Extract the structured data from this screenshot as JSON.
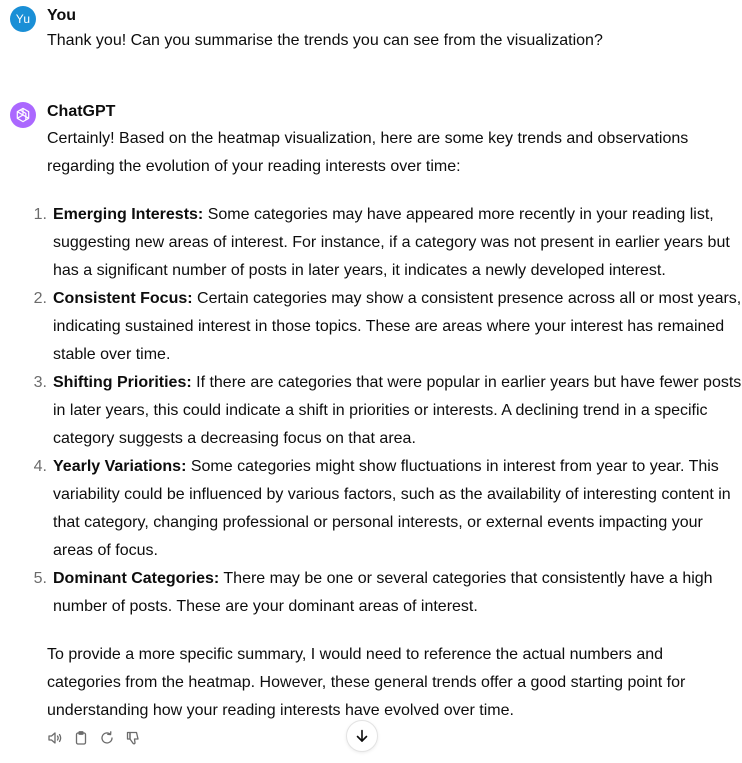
{
  "user_message": {
    "avatar_initials": "Yu",
    "author": "You",
    "text": "Thank you! Can you summarise the trends you can see from the visualization?"
  },
  "assistant_message": {
    "author": "ChatGPT",
    "intro": "Certainly! Based on the heatmap visualization, here are some key trends and observations regarding the evolution of your reading interests over time:",
    "points": [
      {
        "number": "1.",
        "title": "Emerging Interests:",
        "text": " Some categories may have appeared more recently in your reading list, suggesting new areas of interest. For instance, if a category was not present in earlier years but has a significant number of posts in later years, it indicates a newly developed interest."
      },
      {
        "number": "2.",
        "title": "Consistent Focus:",
        "text": " Certain categories may show a consistent presence across all or most years, indicating sustained interest in those topics. These are areas where your interest has remained stable over time."
      },
      {
        "number": "3.",
        "title": "Shifting Priorities:",
        "text": " If there are categories that were popular in earlier years but have fewer posts in later years, this could indicate a shift in priorities or interests. A declining trend in a specific category suggests a decreasing focus on that area."
      },
      {
        "number": "4.",
        "title": "Yearly Variations:",
        "text": " Some categories might show fluctuations in interest from year to year. This variability could be influenced by various factors, such as the availability of interesting content in that category, changing professional or personal interests, or external events impacting your areas of focus."
      },
      {
        "number": "5.",
        "title": "Dominant Categories:",
        "text": " There may be one or several categories that consistently have a high number of posts. These are your dominant areas of interest."
      }
    ],
    "outro": "To provide a more specific summary, I would need to reference the actual numbers and categories from the heatmap. However, these general trends offer a good starting point for understanding how your reading interests have evolved over time.",
    "actions": [
      "read-aloud-icon",
      "copy-icon",
      "regenerate-icon",
      "thumbs-down-icon"
    ]
  },
  "scroll_button": {
    "icon": "arrow-down-icon"
  },
  "colors": {
    "user_avatar": "#1a8fd6",
    "bot_avatar": "#ab68ff",
    "text": "#0d0d0d",
    "icon": "#6b6b6b"
  }
}
